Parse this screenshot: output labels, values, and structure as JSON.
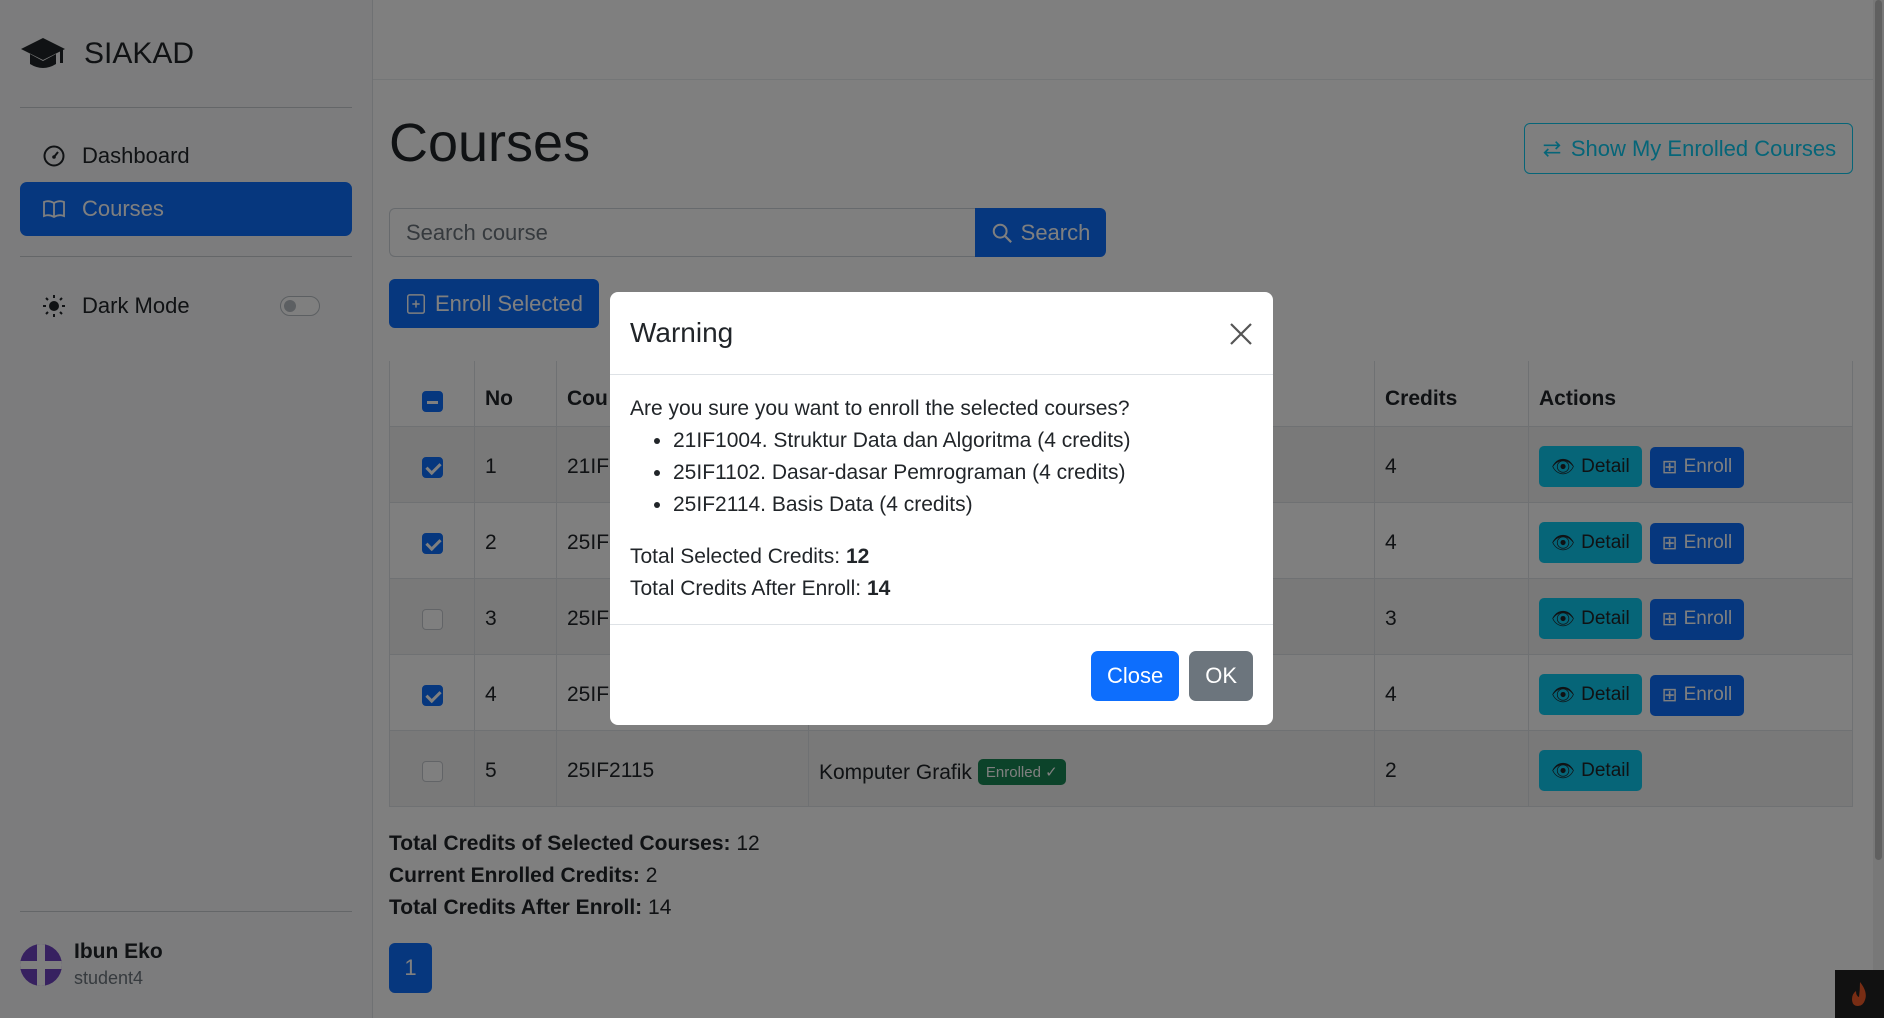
{
  "brand": {
    "name": "SIAKAD"
  },
  "sidebar": {
    "items": [
      {
        "label": "Dashboard",
        "icon": "speedometer-icon",
        "active": false
      },
      {
        "label": "Courses",
        "icon": "book-icon",
        "active": true
      }
    ],
    "dark_mode_label": "Dark Mode",
    "dark_mode_on": false
  },
  "user": {
    "name": "Ibun Eko",
    "username": "student4"
  },
  "page": {
    "title": "Courses",
    "show_enrolled_label": "Show My Enrolled Courses",
    "search_placeholder": "Search course",
    "search_value": "",
    "search_label": "Search",
    "enroll_selected_label": "Enroll Selected"
  },
  "table": {
    "headers": [
      "No",
      "Cou",
      "",
      "Credits",
      "Actions"
    ],
    "rows": [
      {
        "checked": true,
        "no": "1",
        "code": "21IF",
        "name": "",
        "credits": "4",
        "enrolled": false
      },
      {
        "checked": true,
        "no": "2",
        "code": "25IF",
        "name": "",
        "credits": "4",
        "enrolled": false
      },
      {
        "checked": false,
        "no": "3",
        "code": "25IF",
        "name": "",
        "credits": "3",
        "enrolled": false
      },
      {
        "checked": true,
        "no": "4",
        "code": "25IF",
        "name": "",
        "credits": "4",
        "enrolled": false
      },
      {
        "checked": false,
        "no": "5",
        "code": "25IF2115",
        "name": "Komputer Grafik",
        "credits": "2",
        "enrolled": true
      }
    ],
    "detail_label": "Detail",
    "enroll_label": "Enroll",
    "enrolled_badge": "Enrolled ✓"
  },
  "totals": {
    "selected_label": "Total Credits of Selected Courses:",
    "selected_value": "12",
    "current_label": "Current Enrolled Credits:",
    "current_value": "2",
    "after_label": "Total Credits After Enroll:",
    "after_value": "14"
  },
  "pagination": {
    "current": "1"
  },
  "modal": {
    "title": "Warning",
    "message": "Are you sure you want to enroll the selected courses?",
    "items": [
      "21IF1004. Struktur Data dan Algoritma (4 credits)",
      "25IF1102. Dasar-dasar Pemrograman (4 credits)",
      "25IF2114. Basis Data (4 credits)"
    ],
    "total_selected_label": "Total Selected Credits:",
    "total_selected_value": "12",
    "total_after_label": "Total Credits After Enroll:",
    "total_after_value": "14",
    "close_label": "Close",
    "ok_label": "OK"
  },
  "colors": {
    "primary": "#0d6efd",
    "info": "#0dcaf0",
    "success": "#198754",
    "secondary": "#6c757d"
  }
}
